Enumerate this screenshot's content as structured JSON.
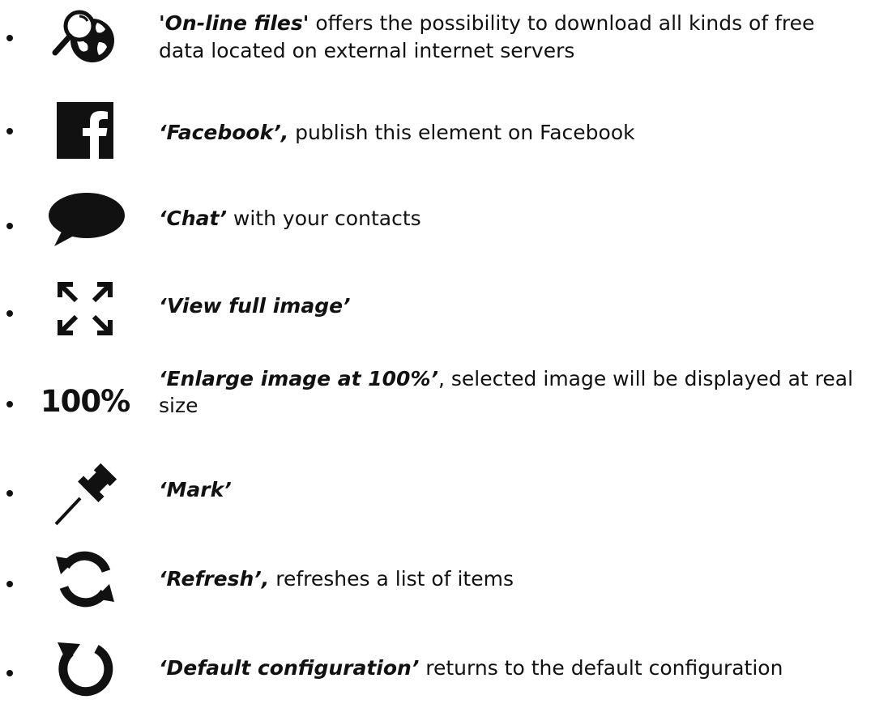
{
  "items": [
    {
      "icon": "online-files-icon",
      "term": "'On-line files'",
      "rest": " offers the possibility to download all kinds of free data located on external internet servers"
    },
    {
      "icon": "facebook-icon",
      "term": "‘Facebook’,",
      "rest": " publish this element on Facebook"
    },
    {
      "icon": "chat-bubble-icon",
      "term": "‘Chat’",
      "rest": " with your contacts"
    },
    {
      "icon": "fullscreen-arrows-icon",
      "term": "‘View full image’",
      "rest": ""
    },
    {
      "icon": "zoom-100-icon",
      "icon_text": "100%",
      "term": "‘Enlarge image at 100%’",
      "rest": ", selected image will be displayed at real size"
    },
    {
      "icon": "pushpin-icon",
      "term": "‘Mark’",
      "rest": ""
    },
    {
      "icon": "refresh-icon",
      "term": "‘Refresh’,",
      "rest": " refreshes a list of items"
    },
    {
      "icon": "default-config-icon",
      "term": "‘Default configuration’",
      "rest": " returns to the default configuration"
    }
  ]
}
